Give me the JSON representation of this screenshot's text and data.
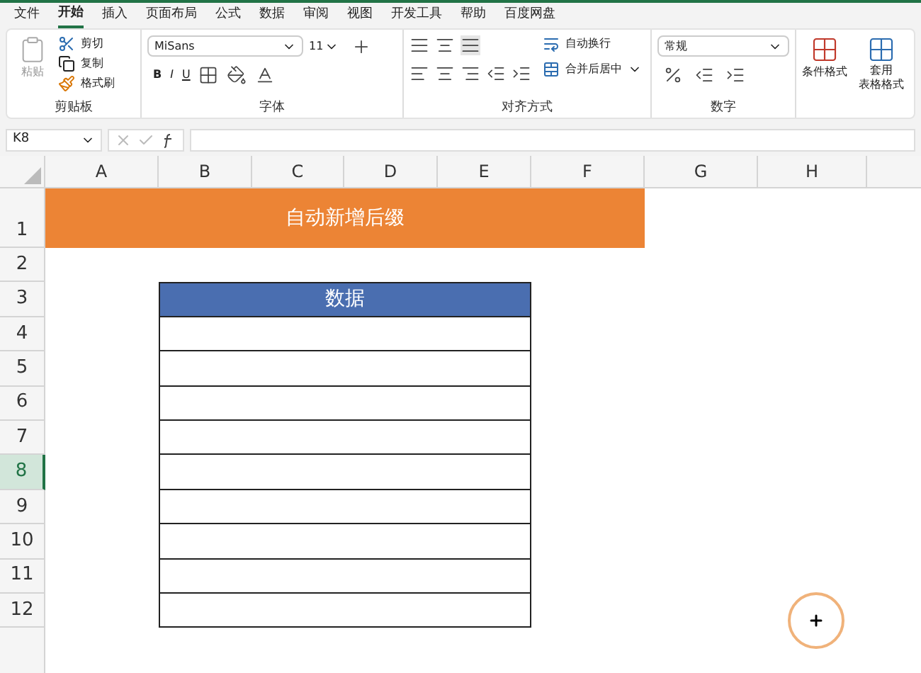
{
  "ribbon_tabs": [
    {
      "label": "文件",
      "selected": false
    },
    {
      "label": "开始",
      "selected": true
    },
    {
      "label": "插入",
      "selected": false
    },
    {
      "label": "页面布局",
      "selected": false
    },
    {
      "label": "公式",
      "selected": false
    },
    {
      "label": "数据",
      "selected": false
    },
    {
      "label": "审阅",
      "selected": false
    },
    {
      "label": "视图",
      "selected": false
    },
    {
      "label": "开发工具",
      "selected": false
    },
    {
      "label": "帮助",
      "selected": false
    },
    {
      "label": "百度网盘",
      "selected": false
    }
  ],
  "clipboard": {
    "paste": "粘贴",
    "cut": "剪切",
    "copy": "复制",
    "format_painter": "格式刷",
    "group": "剪贴板"
  },
  "font": {
    "name": "MiSans",
    "size": "11",
    "bold": "B",
    "italic": "I",
    "underline": "U",
    "group": "字体"
  },
  "alignment": {
    "wrap": "自动换行",
    "merge": "合并后居中",
    "group": "对齐方式"
  },
  "number": {
    "format": "常规",
    "group": "数字"
  },
  "styles": {
    "conditional": "条件格式",
    "table_format": "套用",
    "table_format_2": "表格格式"
  },
  "name_box": "K8",
  "columns": [
    "A",
    "B",
    "C",
    "D",
    "E",
    "F",
    "G",
    "H"
  ],
  "rows": [
    {
      "label": "1",
      "selected": false,
      "kind": "title",
      "text": "自动新增后缀"
    },
    {
      "label": "2",
      "selected": false,
      "kind": "blank"
    },
    {
      "label": "3",
      "selected": false,
      "kind": "table-header",
      "text": "数据"
    },
    {
      "label": "4",
      "selected": false,
      "kind": "table-row"
    },
    {
      "label": "5",
      "selected": false,
      "kind": "table-row"
    },
    {
      "label": "6",
      "selected": false,
      "kind": "table-row"
    },
    {
      "label": "7",
      "selected": false,
      "kind": "table-row"
    },
    {
      "label": "8",
      "selected": true,
      "kind": "table-row"
    },
    {
      "label": "9",
      "selected": false,
      "kind": "table-row"
    },
    {
      "label": "10",
      "selected": false,
      "kind": "table-row"
    },
    {
      "label": "11",
      "selected": false,
      "kind": "table-row"
    },
    {
      "label": "12",
      "selected": false,
      "kind": "table-row"
    }
  ]
}
